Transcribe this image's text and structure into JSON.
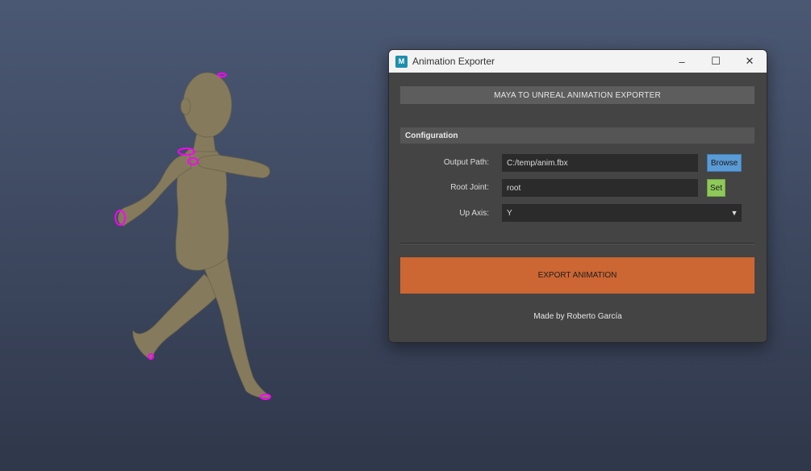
{
  "window": {
    "title": "Animation Exporter",
    "app_icon_letter": "M",
    "controls": {
      "minimize": "–",
      "maximize": "☐",
      "close": "✕"
    }
  },
  "tool": {
    "header": "MAYA TO UNREAL ANIMATION EXPORTER",
    "section_title": "Configuration",
    "output_path": {
      "label": "Output Path:",
      "value": "C:/temp/anim.fbx",
      "button": "Browse"
    },
    "root_joint": {
      "label": "Root Joint:",
      "value": "root",
      "button": "Set"
    },
    "up_axis": {
      "label": "Up Axis:",
      "selected": "Y"
    },
    "export_button": "EXPORT ANIMATION",
    "footer": "Made by Roberto García"
  },
  "colors": {
    "browse": "#5b9bd5",
    "set": "#8ec95a",
    "export": "#cc6633",
    "controls_highlight": "#ff00ff"
  }
}
